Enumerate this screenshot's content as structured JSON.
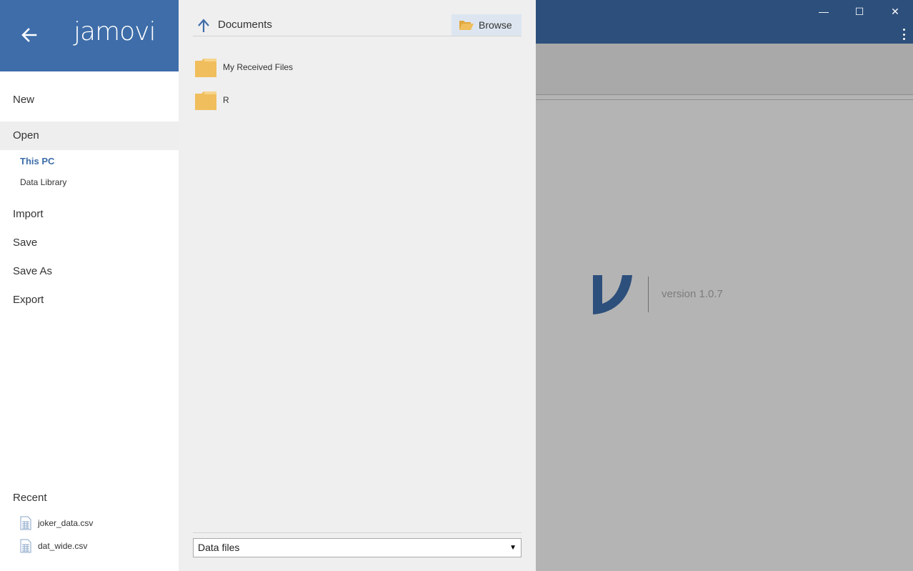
{
  "app": {
    "brand": "jamovi",
    "version_text": "version 1.0.7",
    "accent_color": "#3e6da9",
    "titlebar_color": "#2d4f7c"
  },
  "window_controls": {
    "minimize": "—",
    "maximize": "☐",
    "close": "✕"
  },
  "menu": {
    "new": "New",
    "open": "Open",
    "open_sub": {
      "this_pc": "This PC",
      "data_library": "Data Library"
    },
    "import": "Import",
    "save": "Save",
    "save_as": "Save As",
    "export": "Export"
  },
  "recent": {
    "label": "Recent",
    "files": [
      "joker_data.csv",
      "dat_wide.csv"
    ]
  },
  "browser": {
    "path": "Documents",
    "browse_label": "Browse",
    "folders": [
      "My Received Files",
      "R"
    ],
    "filter_value": "Data files",
    "folder_color": "#f0be5c"
  },
  "icons": {
    "back": "arrow-left-icon",
    "up": "arrow-up-icon",
    "browse": "folder-open-icon",
    "folder": "folder-icon",
    "file": "csv-file-icon",
    "more": "kebab-menu-icon"
  }
}
